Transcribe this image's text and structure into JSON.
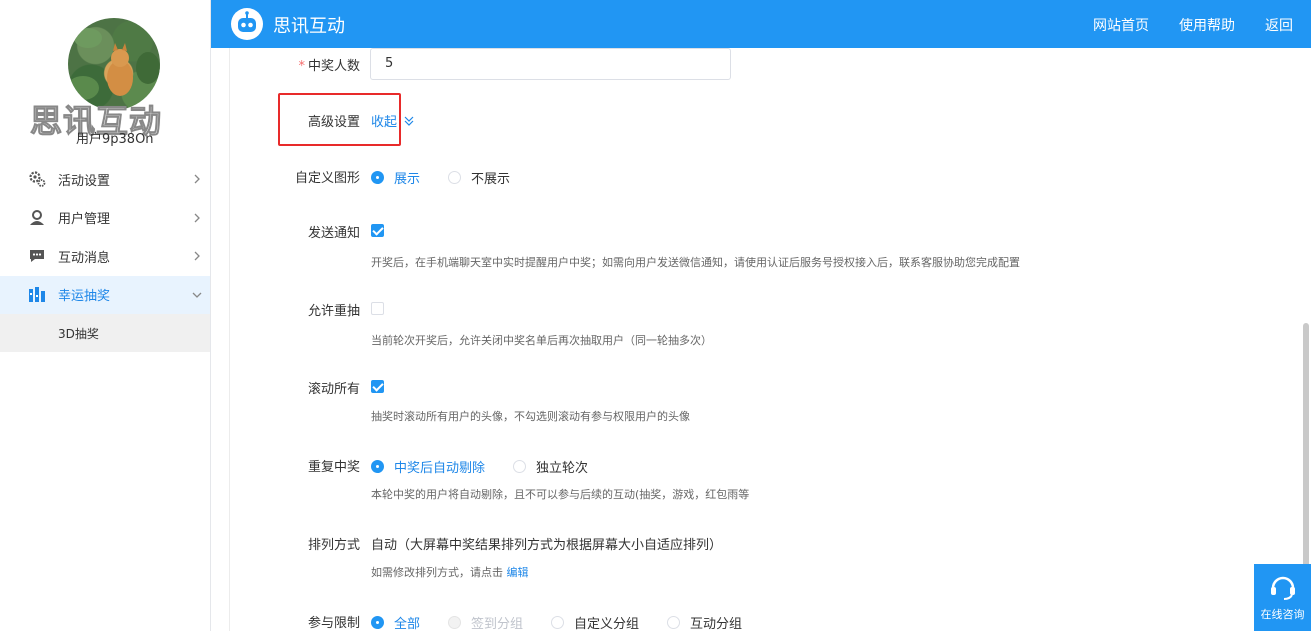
{
  "sidebar": {
    "brand_watermark": "思讯互动",
    "user_name": "用户9p38On",
    "items": [
      {
        "label": "活动设置",
        "icon": "gear-icon"
      },
      {
        "label": "用户管理",
        "icon": "user-icon"
      },
      {
        "label": "互动消息",
        "icon": "chat-icon"
      },
      {
        "label": "幸运抽奖",
        "icon": "lottery-icon",
        "active": true
      }
    ],
    "sub_items": [
      {
        "label": "3D抽奖"
      }
    ]
  },
  "header": {
    "title": "思讯互动",
    "links": [
      "网站首页",
      "使用帮助",
      "返回"
    ]
  },
  "form": {
    "winners": {
      "label": "中奖人数",
      "value": "5"
    },
    "advanced": {
      "label": "高级设置",
      "toggle": "收起"
    },
    "custom_shape": {
      "label": "自定义图形",
      "options": [
        "展示",
        "不展示"
      ],
      "selected": "展示"
    },
    "send_notice": {
      "label": "发送通知",
      "checked": true,
      "hint": "开奖后，在手机端聊天室中实时提醒用户中奖；如需向用户发送微信通知，请使用认证后服务号授权接入后，联系客服协助您完成配置"
    },
    "allow_redraw": {
      "label": "允许重抽",
      "checked": false,
      "hint": "当前轮次开奖后，允许关闭中奖名单后再次抽取用户（同一轮抽多次）"
    },
    "scroll_all": {
      "label": "滚动所有",
      "checked": true,
      "hint": "抽奖时滚动所有用户的头像，不勾选则滚动有参与权限用户的头像"
    },
    "repeat_win": {
      "label": "重复中奖",
      "options": [
        "中奖后自动剔除",
        "独立轮次"
      ],
      "selected": "中奖后自动剔除",
      "hint": "本轮中奖的用户将自动剔除，且不可以参与后续的互动(抽奖，游戏，红包雨等"
    },
    "arrange": {
      "label": "排列方式",
      "value": "自动（大屏幕中奖结果排列方式为根据屏幕大小自适应排列）",
      "hint_prefix": "如需修改排列方式，请点击",
      "hint_link": "编辑"
    },
    "participation": {
      "label": "参与限制",
      "options": [
        "全部",
        "签到分组",
        "自定义分组",
        "互动分组"
      ],
      "selected": "全部",
      "disabled": [
        "签到分组"
      ]
    }
  },
  "consult": {
    "label": "在线咨询"
  },
  "colors": {
    "primary": "#2196f3",
    "highlight": "#e82a2a"
  }
}
